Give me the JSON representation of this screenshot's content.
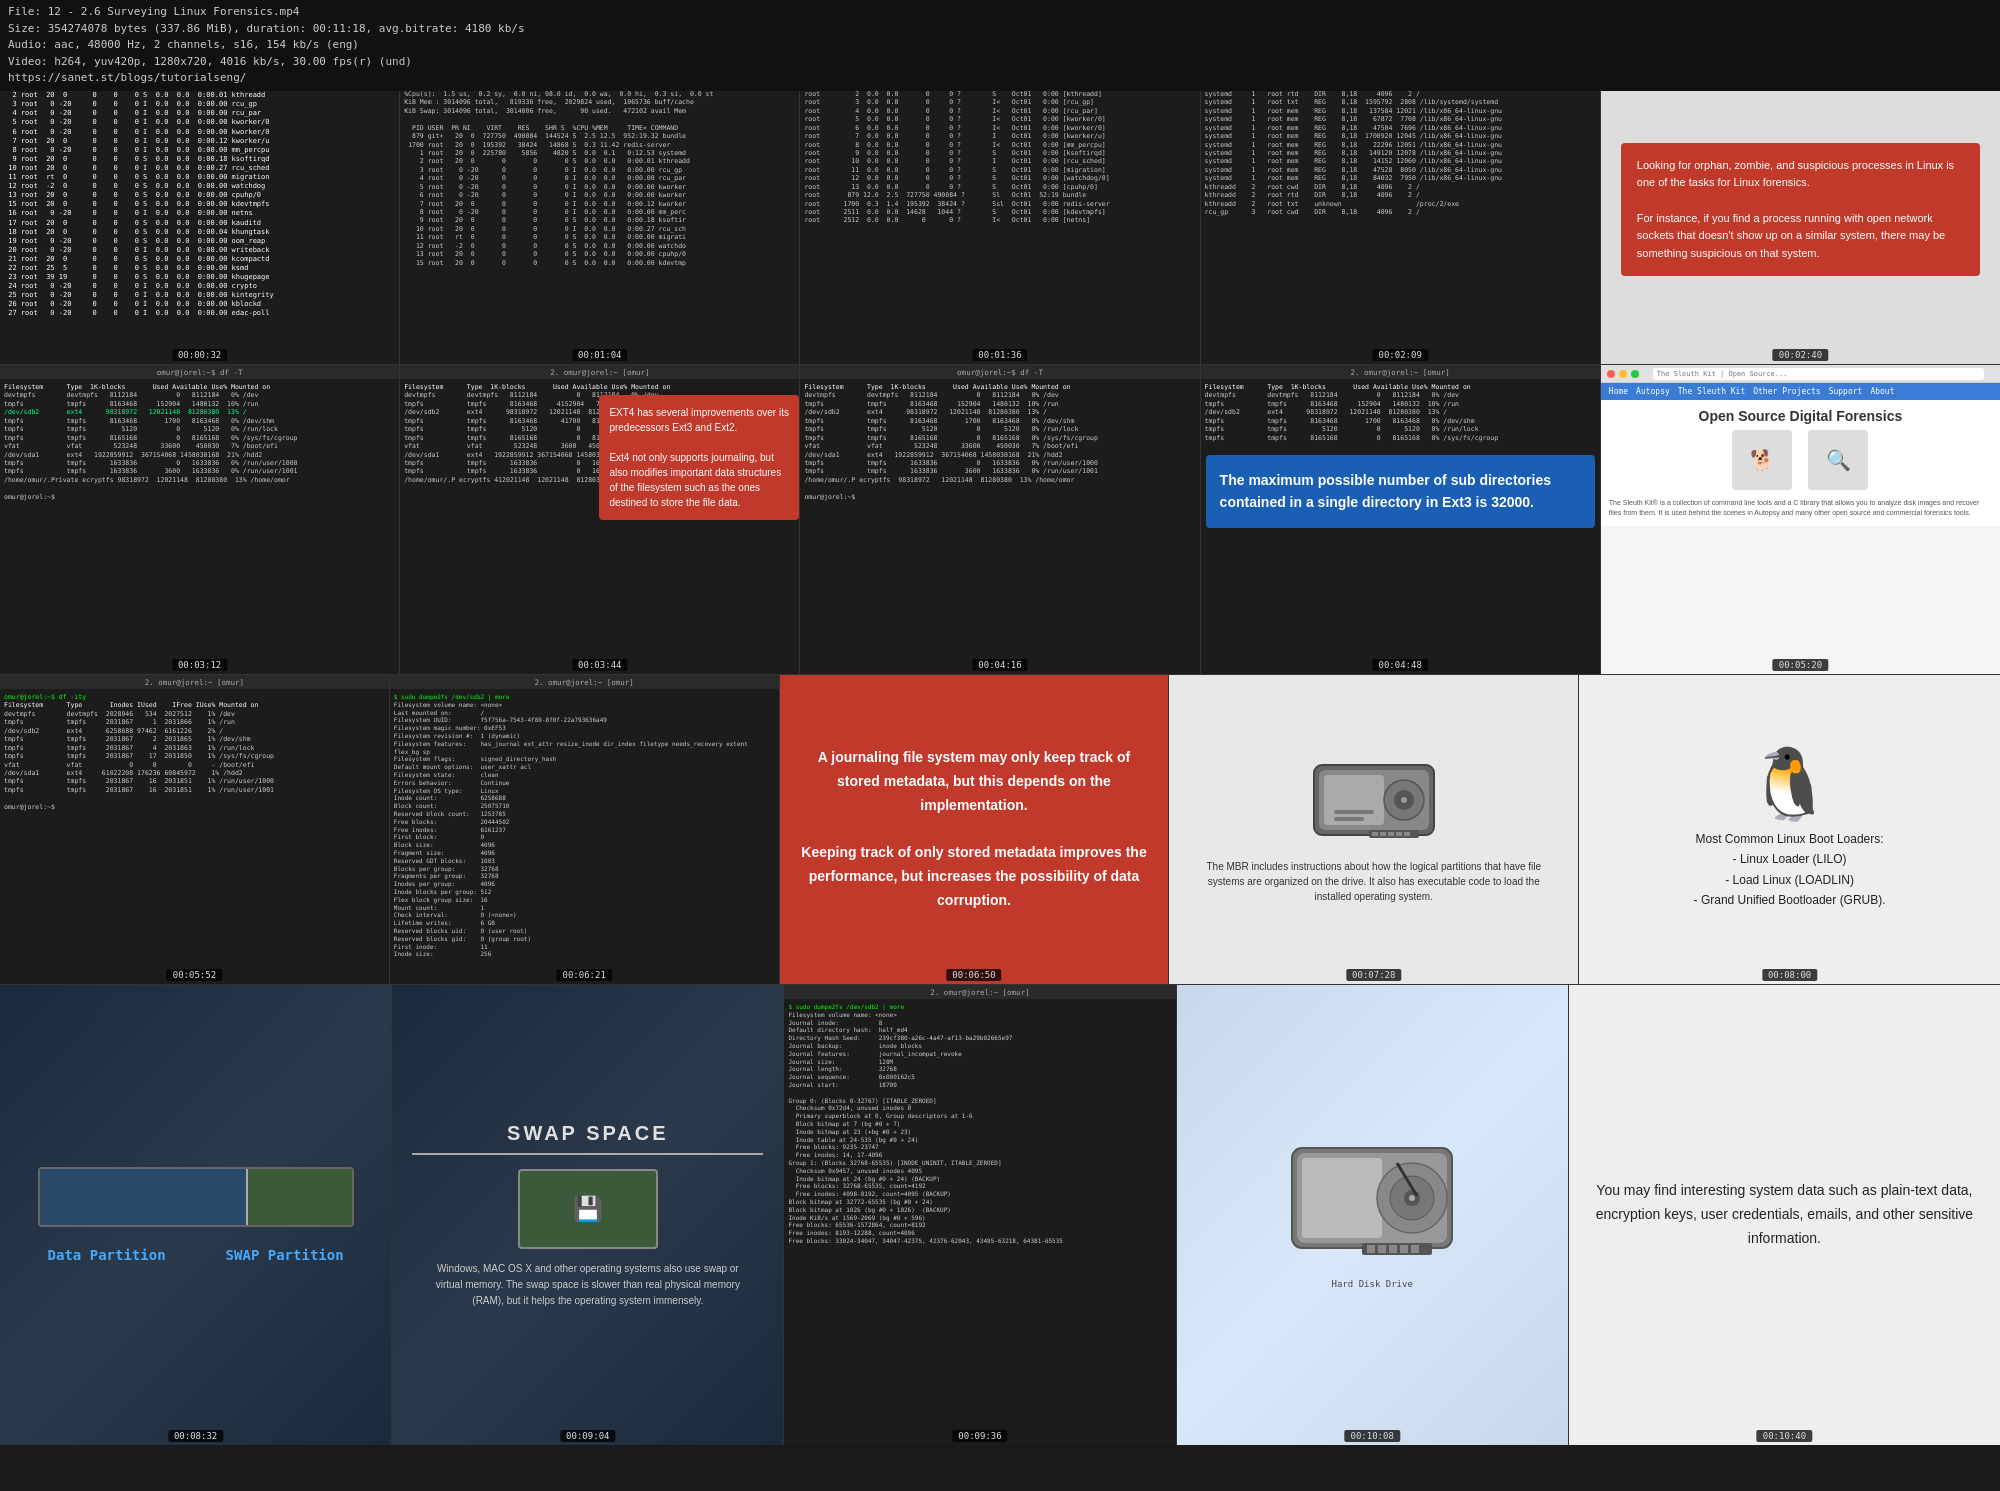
{
  "file_info": {
    "line1": "File: 12 - 2.6 Surveying Linux Forensics.mp4",
    "line2": "Size: 354274078 bytes (337.86 MiB), duration: 00:11:18, avg.bitrate: 4180 kb/s",
    "line3": "Audio: aac, 48000 Hz, 2 channels, s16, 154 kb/s (eng)",
    "line4": "Video: h264, yuv420p, 1280x720, 4016 kb/s, 30.00 fps(r) (und)",
    "line5": "https://sanet.st/blogs/tutorialseng/"
  },
  "timestamps": {
    "t1": "00:00:32",
    "t2": "00:01:04",
    "t3": "00:01:36",
    "t4": "00:02:09",
    "t5": "00:02:40",
    "t6": "00:03:12",
    "t7": "00:03:44",
    "t8": "00:04:16",
    "t9": "00:04:48",
    "t10": "00:05:20",
    "t11": "00:05:52",
    "t12": "00:06:21",
    "t13": "00:06:50",
    "t14": "00:07:28",
    "t15": "00:08:00",
    "t16": "00:08:32",
    "t17": "00:09:04",
    "t18": "00:09:36",
    "t19": "00:10:08",
    "t20": "00:10:40"
  },
  "info_bubbles": {
    "orphan_zombie": "Looking for orphan, zombie, and suspicious processes in Linux is one of the tasks for Linux forensics.\n\nFor instance, if you find a process running with open network sockets that doesn't show up on a similar system, there may be something suspicious on that system.",
    "ext4_improvements": "EXT4 has several improvements over its predecessors Ext3 and Ext2.\n\nExt4 not only supports journaling, but also modifies important data structures of the filesystem such as the ones destined to store the file data.",
    "max_subdirs": "The maximum possible number of sub directories contained in a single directory in Ext3 is 32000.",
    "journaling": "A journaling file system may only keep track of stored metadata, but this depends on the implementation.\n\nKeeping track of only stored metadata improves the performance, but increases the possibility of data corruption.",
    "mbr": "The MBR includes instructions about how the logical partitions that have file systems are organized on the drive. It also has executable code to load the installed operating system.",
    "boot_loaders": "Most Common Linux Boot Loaders:\n- Linux Loader (LILO)\n- Load Linux (LOADLIN)\n- Grand Unified Bootloader (GRUB).",
    "swap_desc": "Windows, MAC OS X and other operating systems also use swap or virtual memory. The swap space is slower than real physical memory (RAM), but it helps the operating system immensely.",
    "sensitive": "You may find interesting system data such as plain-text data, encryption keys, user credentials, emails, and other sensitive information."
  },
  "swap": {
    "title": "SWAP SPACE"
  },
  "partition": {
    "data": "Data Partition",
    "swap": "SWAP Partition"
  },
  "df_output": {
    "header": "Filesystem      Type  1K-blocks      Used Available Use% Mounted on",
    "rows": [
      "devtmpfs        devtmpfs   8112184         0   8112184   0% /dev",
      "tmpfs           tmpfs      8163468    152904   1480132  10% /run",
      "/dev/sdb2       ext4      98318972  12021148  81280380  13% /",
      "tmpfs           tmpfs      8163468      1700    8163468   0% /dev/shm",
      "tmpfs           tmpfs         5120         0      5120   0% /run/lock",
      "tmpfs           tmpfs      8165168         0   8165168   0% /sys/fs/cgroup",
      "vfat            vfat        523248     33600    450030   7% /boot/efi",
      "/dev/sda1       ext4    1922859912 367154068 1458030168  21% /hdd2",
      "tmpfs           tmpfs      1633836         0   1633836   0% /run/user/1000",
      "tmpfs           tmpfs      1633836      3600   1633836   0% /run/user/1001",
      "/home/omor/.Private ecryptfs 98318972  12021148  81280380  13% /home/omor"
    ],
    "prompt": "omur@jorel:~$ df -T"
  }
}
